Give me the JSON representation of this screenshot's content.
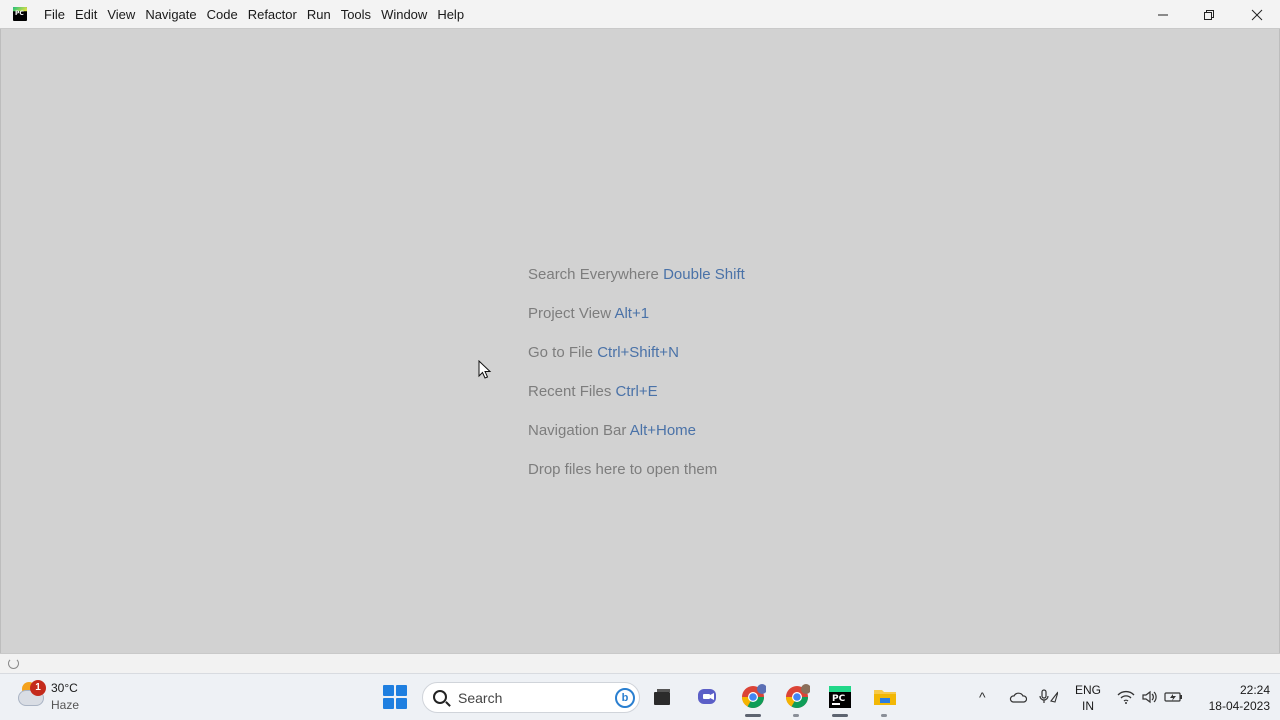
{
  "window": {
    "menu": [
      {
        "label": "File"
      },
      {
        "label": "Edit"
      },
      {
        "label": "View"
      },
      {
        "label": "Navigate"
      },
      {
        "label": "Code"
      },
      {
        "label": "Refactor"
      },
      {
        "label": "Run"
      },
      {
        "label": "Tools"
      },
      {
        "label": "Window"
      },
      {
        "label": "Help"
      }
    ],
    "controls": [
      "minimize-icon",
      "restore-icon",
      "close-icon"
    ]
  },
  "workspace": {
    "hints": [
      {
        "text": "Search Everywhere",
        "key": "Double Shift"
      },
      {
        "text": "Project View",
        "key": "Alt+1"
      },
      {
        "text": "Go to File",
        "key": "Ctrl+Shift+N"
      },
      {
        "text": "Recent Files",
        "key": "Ctrl+E"
      },
      {
        "text": "Navigation Bar",
        "key": "Alt+Home"
      },
      {
        "text": "Drop files here to open them",
        "key": ""
      }
    ]
  },
  "taskbar": {
    "weather": {
      "badge": "1",
      "temperature": "30°C",
      "condition": "Haze"
    },
    "search_placeholder": "Search",
    "apps": [
      "start-icon",
      "file-explorer-icon",
      "teams-icon",
      "chrome-icon",
      "chrome-profile-icon",
      "pycharm-icon",
      "folder-icon"
    ],
    "tray": {
      "language": "ENG",
      "region": "IN",
      "time": "22:24",
      "date": "18-04-2023"
    }
  },
  "colors": {
    "workspace_bg": "#d2d2d2",
    "hint_text": "#7d7d7d",
    "hint_key": "#4a72a8",
    "taskbar_bg": "#eef1f5"
  }
}
